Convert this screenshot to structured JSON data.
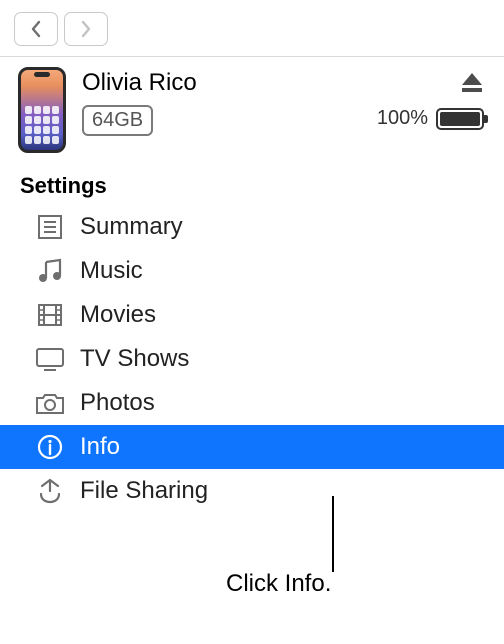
{
  "toolbar": {
    "back": "Back",
    "forward": "Forward"
  },
  "device": {
    "name": "Olivia Rico",
    "storage": "64GB",
    "battery_text": "100%",
    "battery_percent": 100
  },
  "section_heading": "Settings",
  "settings_items": [
    {
      "id": "summary",
      "label": "Summary",
      "icon": "summary-icon",
      "selected": false
    },
    {
      "id": "music",
      "label": "Music",
      "icon": "music-icon",
      "selected": false
    },
    {
      "id": "movies",
      "label": "Movies",
      "icon": "movies-icon",
      "selected": false
    },
    {
      "id": "tvshows",
      "label": "TV Shows",
      "icon": "tv-icon",
      "selected": false
    },
    {
      "id": "photos",
      "label": "Photos",
      "icon": "photos-icon",
      "selected": false
    },
    {
      "id": "info",
      "label": "Info",
      "icon": "info-icon",
      "selected": true
    },
    {
      "id": "filesharing",
      "label": "File Sharing",
      "icon": "filesharing-icon",
      "selected": false
    }
  ],
  "callout": "Click Info."
}
